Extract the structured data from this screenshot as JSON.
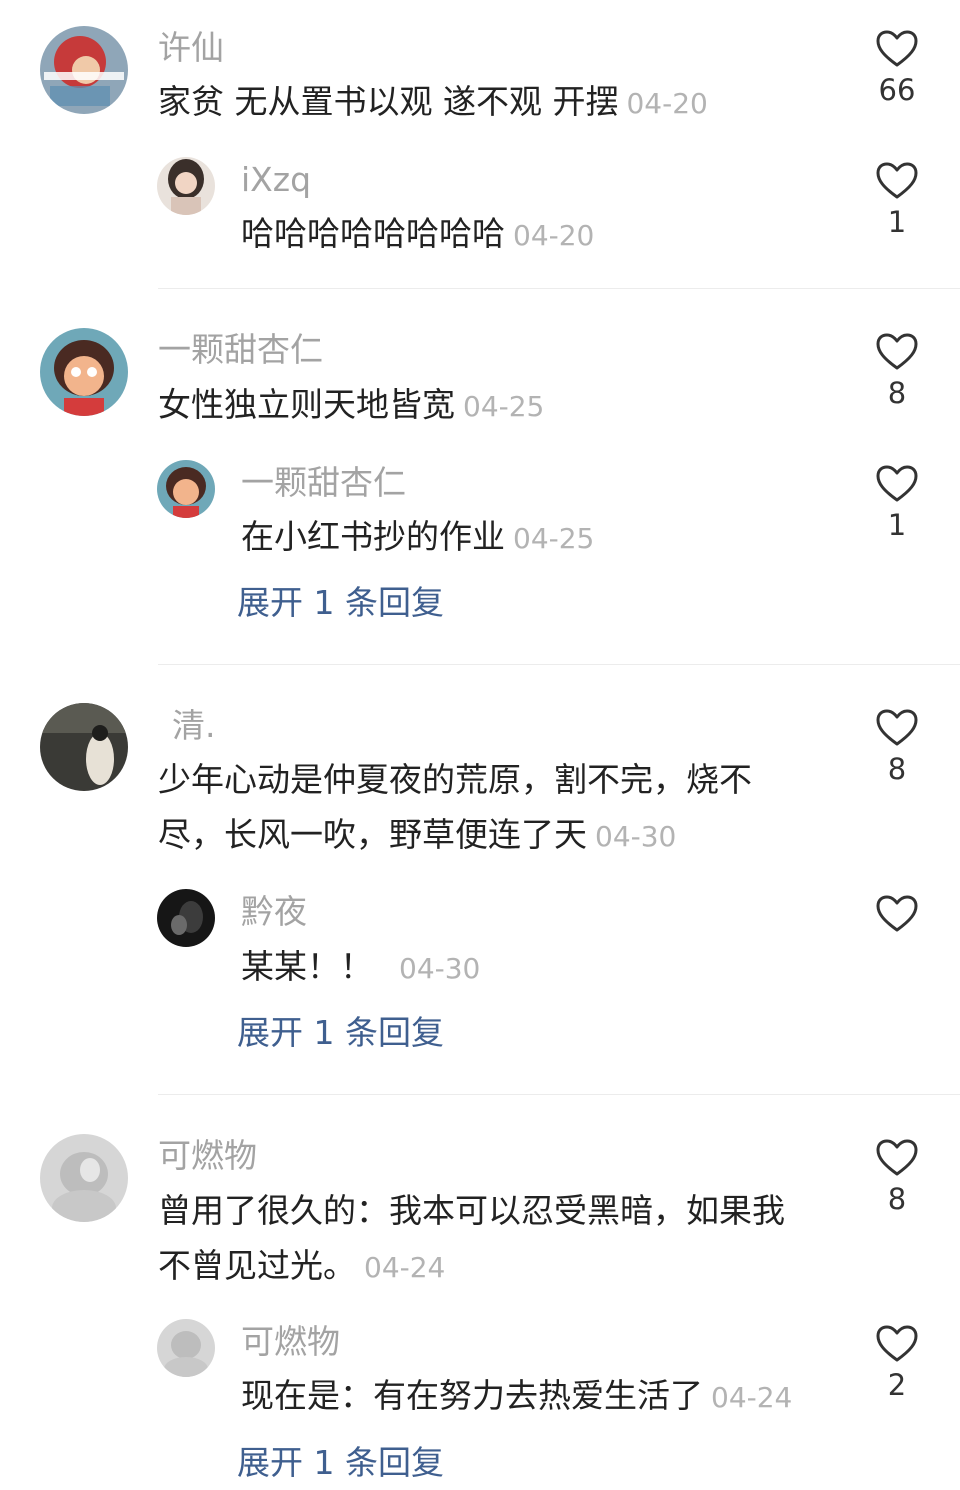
{
  "threads": [
    {
      "main": {
        "user": "许仙",
        "text": "家贫 无从置书以观 遂不观 开摆",
        "date": "04-20",
        "likes": "66"
      },
      "reply": {
        "user": "iXzq",
        "text": "哈哈哈哈哈哈哈哈",
        "date": "04-20",
        "likes": "1"
      }
    },
    {
      "main": {
        "user": "一颗甜杏仁",
        "text": "女性独立则天地皆宽",
        "date": "04-25",
        "likes": "8"
      },
      "reply": {
        "user": "一颗甜杏仁",
        "text": "在小红书抄的作业",
        "date": "04-25",
        "likes": "1"
      },
      "expand": "展开 1 条回复"
    },
    {
      "main": {
        "user": "清.",
        "text_line1": "少年心动是仲夏夜的荒原，割不完，烧不",
        "text_line2": "尽，长风一吹，野草便连了天",
        "date": "04-30",
        "likes": "8"
      },
      "reply": {
        "user": "黔夜",
        "text": "某某！！",
        "date": "04-30",
        "likes": ""
      },
      "expand": "展开 1 条回复"
    },
    {
      "main": {
        "user": "可燃物",
        "text_line1": "曾用了很久的：我本可以忍受黑暗，如果我",
        "text_line2": "不曾见过光。",
        "date": "04-24",
        "likes": "8"
      },
      "reply": {
        "user": "可燃物",
        "text": "现在是：有在努力去热爱生活了",
        "date": "04-24",
        "likes": "2"
      },
      "expand": "展开 1 条回复"
    }
  ]
}
